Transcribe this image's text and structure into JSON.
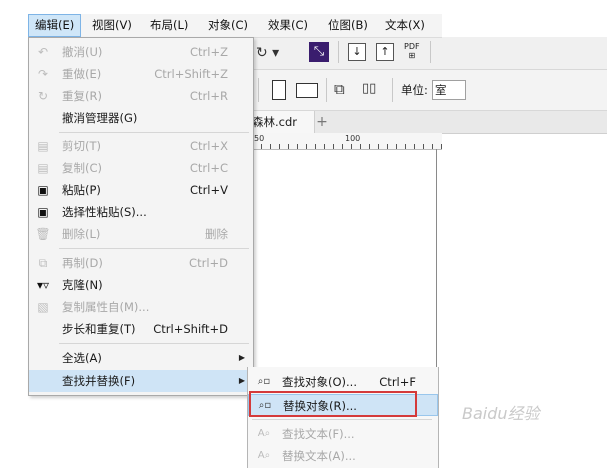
{
  "menubar": {
    "items": [
      "编辑(E)",
      "视图(V)",
      "布局(L)",
      "对象(C)",
      "效果(C)",
      "位图(B)",
      "文本(X)"
    ],
    "active_index": 0
  },
  "toolbar": {
    "redo_icon": "redo-icon",
    "pdf_label": "PDF",
    "unit_label": "单位:",
    "unit_value": "室"
  },
  "document": {
    "tab_title": "森林.cdr",
    "add_tab": "+",
    "ruler_ticks": [
      "50",
      "100"
    ]
  },
  "edit_menu": {
    "items": [
      {
        "label": "撤消(U)",
        "shortcut": "Ctrl+Z",
        "enabled": false,
        "icon": "undo-icon"
      },
      {
        "label": "重做(E)",
        "shortcut": "Ctrl+Shift+Z",
        "enabled": false,
        "icon": "redo-icon"
      },
      {
        "label": "重复(R)",
        "shortcut": "Ctrl+R",
        "enabled": false,
        "icon": "repeat-icon"
      },
      {
        "label": "撤消管理器(G)",
        "shortcut": "",
        "enabled": true,
        "icon": ""
      },
      {
        "label": "剪切(T)",
        "shortcut": "Ctrl+X",
        "enabled": false,
        "icon": "cut-icon"
      },
      {
        "label": "复制(C)",
        "shortcut": "Ctrl+C",
        "enabled": false,
        "icon": "copy-icon"
      },
      {
        "label": "粘贴(P)",
        "shortcut": "Ctrl+V",
        "enabled": true,
        "icon": "paste-icon"
      },
      {
        "label": "选择性粘贴(S)...",
        "shortcut": "",
        "enabled": true,
        "icon": "paste-special-icon"
      },
      {
        "label": "删除(L)",
        "shortcut": "删除",
        "enabled": false,
        "icon": "trash-icon"
      },
      {
        "label": "再制(D)",
        "shortcut": "Ctrl+D",
        "enabled": false,
        "icon": "duplicate-icon"
      },
      {
        "label": "克隆(N)",
        "shortcut": "",
        "enabled": true,
        "icon": "clone-icon"
      },
      {
        "label": "复制属性自(M)...",
        "shortcut": "",
        "enabled": false,
        "icon": "copy-properties-icon"
      },
      {
        "label": "步长和重复(T)",
        "shortcut": "Ctrl+Shift+D",
        "enabled": true,
        "icon": ""
      },
      {
        "label": "全选(A)",
        "shortcut": "",
        "enabled": true,
        "icon": "",
        "submenu": true
      },
      {
        "label": "查找并替换(F)",
        "shortcut": "",
        "enabled": true,
        "icon": "",
        "submenu": true,
        "highlighted": true
      }
    ]
  },
  "find_replace_submenu": {
    "items": [
      {
        "label": "查找对象(O)...",
        "shortcut": "Ctrl+F",
        "enabled": true,
        "icon": "find-objects-icon"
      },
      {
        "label": "替换对象(R)...",
        "shortcut": "",
        "enabled": true,
        "icon": "replace-objects-icon",
        "highlighted": true
      },
      {
        "label": "查找文本(F)...",
        "shortcut": "",
        "enabled": false,
        "icon": "find-text-icon"
      },
      {
        "label": "替换文本(A)...",
        "shortcut": "",
        "enabled": false,
        "icon": "replace-text-icon"
      }
    ]
  },
  "watermark": "Baidu经验",
  "colors": {
    "highlight": "#cfe4f6",
    "annotation_red": "#d43a3a",
    "menu_bg": "#f4f4f4"
  }
}
